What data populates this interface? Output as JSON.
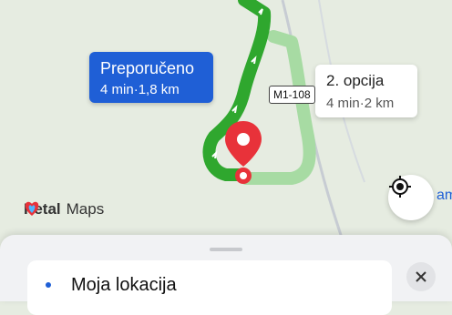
{
  "map": {
    "brand_name_bold": "Petal",
    "brand_name_rest": "Maps",
    "road_label": "M1-108"
  },
  "routes": {
    "recommended": {
      "label": "Preporučeno",
      "duration": "4 min",
      "distance": "1,8 km"
    },
    "alternative": {
      "label": "2. opcija",
      "duration": "4 min",
      "distance": "2 km"
    }
  },
  "partial_text": "am",
  "bottom_sheet": {
    "location_label": "Moja lokacija"
  },
  "colors": {
    "route_primary": "#2fa72e",
    "route_alt": "#a7dba3",
    "marker": "#e8323a",
    "bubble_primary": "#1f5fd6"
  },
  "icons": [
    "map-pin-icon",
    "locate-icon",
    "close-icon",
    "petal-logo-icon"
  ]
}
